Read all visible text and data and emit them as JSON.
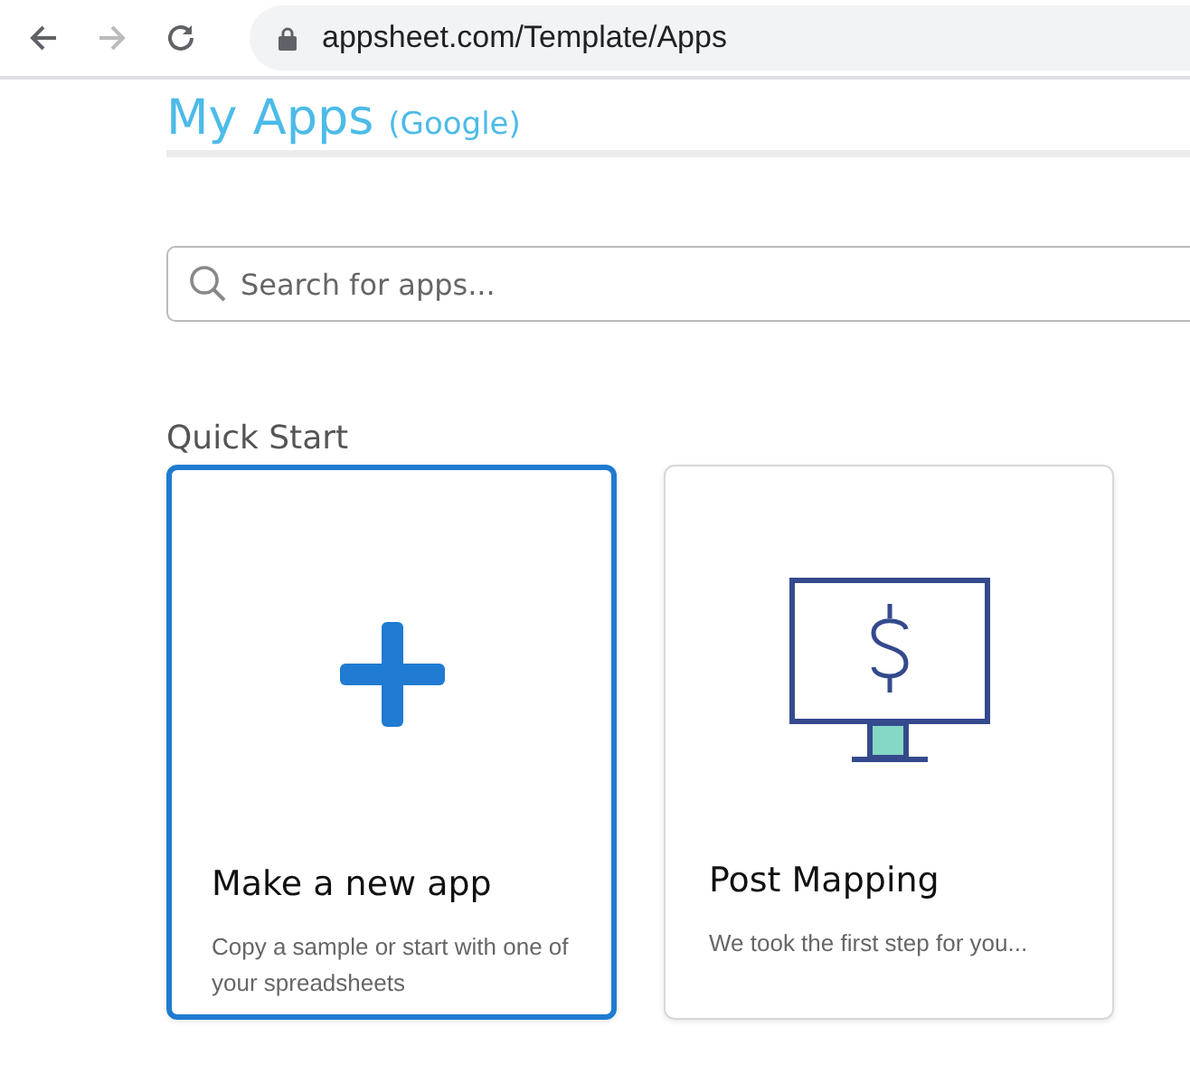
{
  "browser": {
    "nav": [
      {
        "kind": "back",
        "disabled": false
      },
      {
        "kind": "forward",
        "disabled": true
      },
      {
        "kind": "reload",
        "disabled": false
      }
    ],
    "url": "appsheet.com/Template/Apps"
  },
  "page": {
    "title": "My Apps",
    "account": "(Google)"
  },
  "search": {
    "placeholder": "Search for apps..."
  },
  "quick_start": {
    "heading": "Quick Start",
    "cards": [
      {
        "kind": "new",
        "title": "Make a new app",
        "description": "Copy a sample or start with one of your spreadsheets",
        "selected": true
      },
      {
        "kind": "template",
        "title": "Post Mapping",
        "description": "We took the first step for you...",
        "selected": false
      }
    ]
  }
}
